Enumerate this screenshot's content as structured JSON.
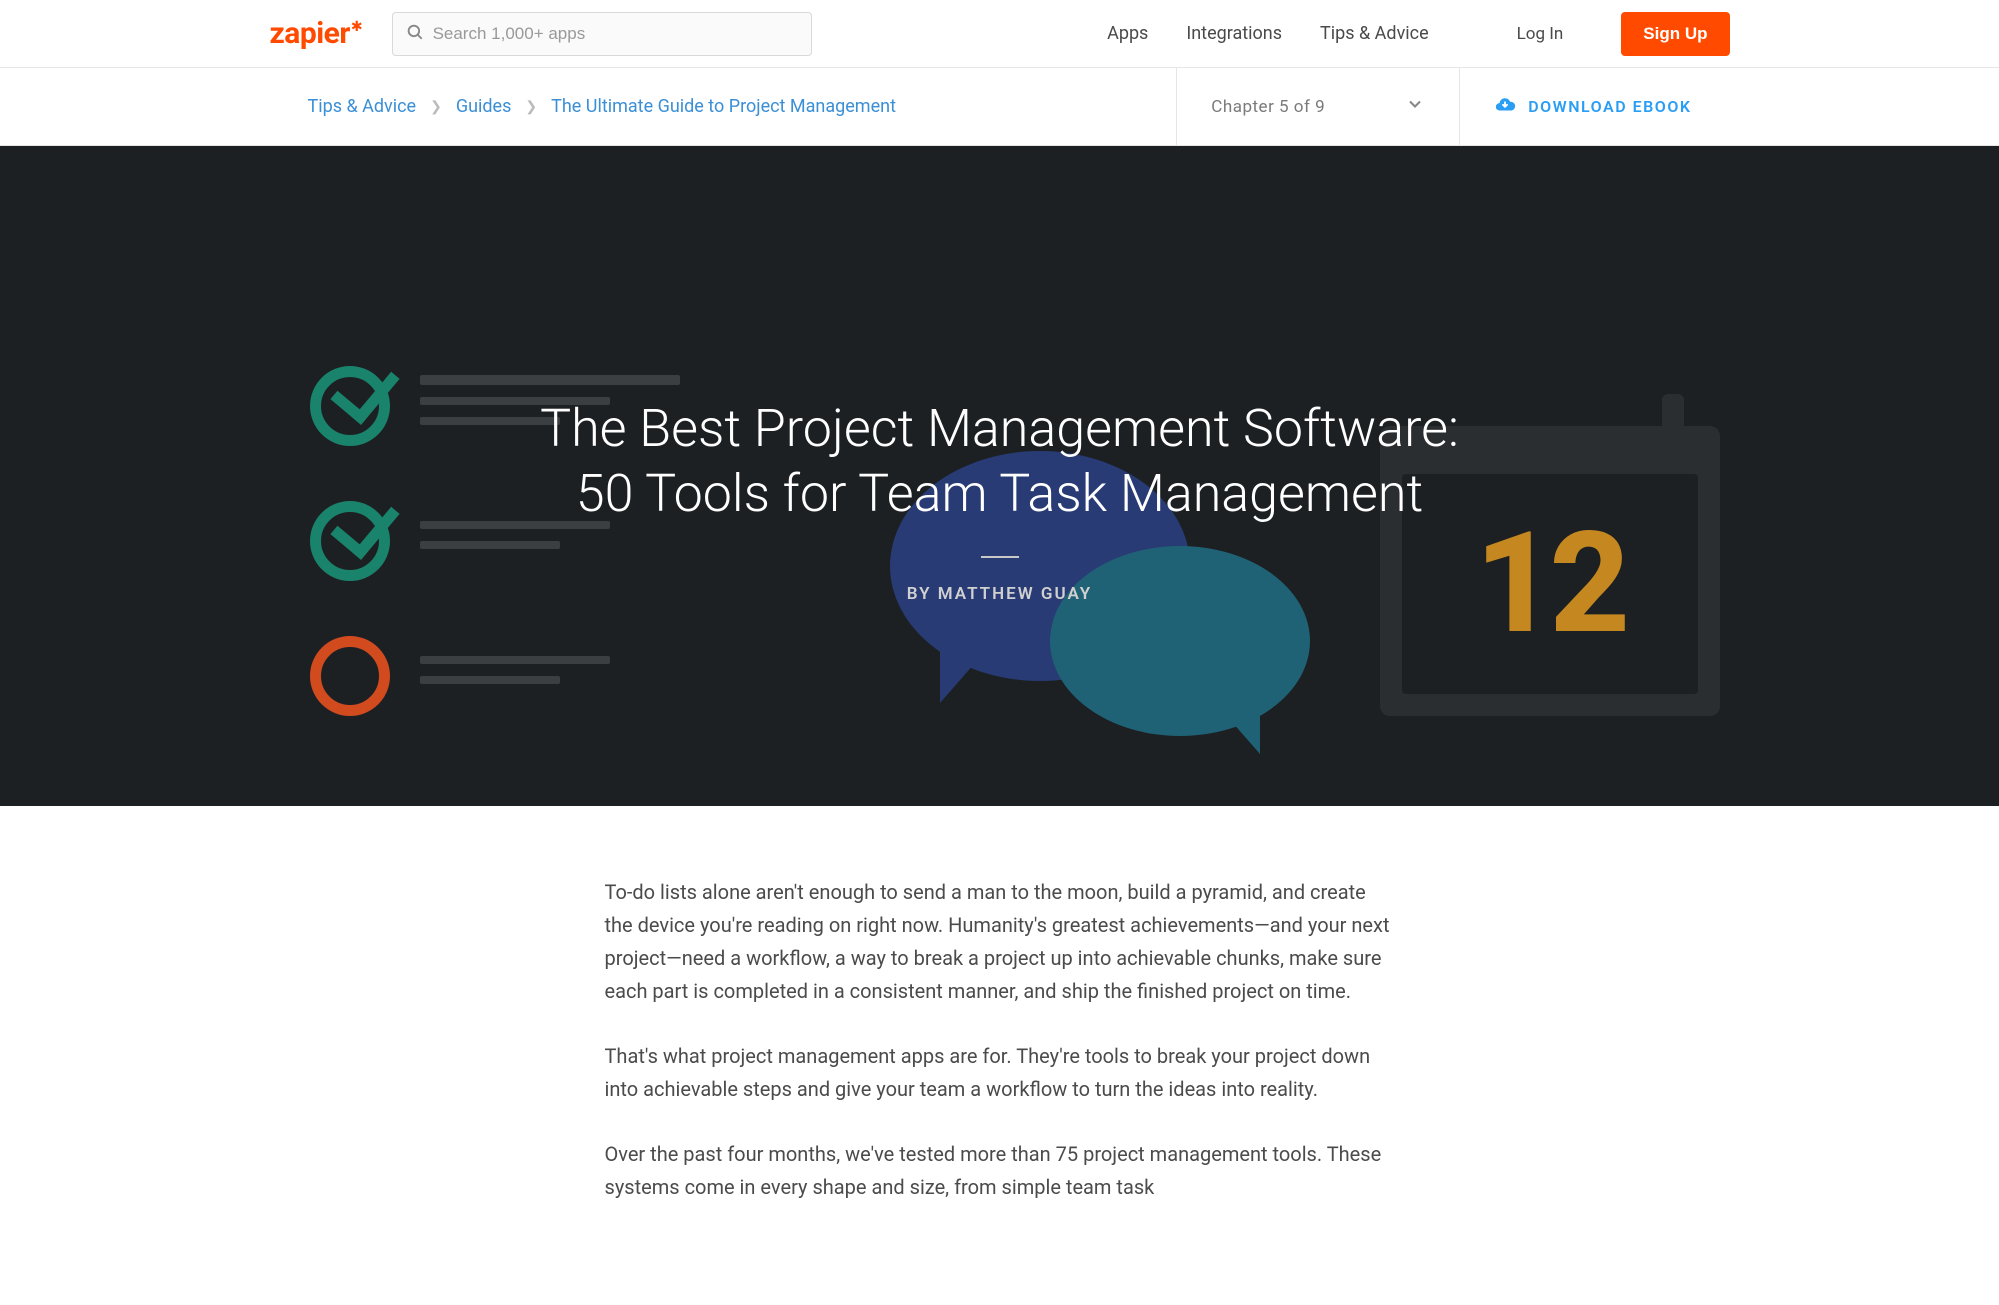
{
  "brand": "zapier",
  "search": {
    "placeholder": "Search 1,000+ apps"
  },
  "nav": {
    "apps": "Apps",
    "integrations": "Integrations",
    "tips": "Tips & Advice",
    "login": "Log In",
    "signup": "Sign Up"
  },
  "breadcrumbs": {
    "tips": "Tips & Advice",
    "guides": "Guides",
    "guide_title": "The Ultimate Guide to Project Management"
  },
  "chapter": {
    "label": "Chapter 5 of 9"
  },
  "download": {
    "label": "DOWNLOAD EBOOK"
  },
  "hero": {
    "title_line1": "The Best Project Management Software:",
    "title_line2": "50 Tools for Team Task Management",
    "byline": "BY MATTHEW GUAY",
    "calendar_day": "12"
  },
  "article": {
    "p1": "To-do lists alone aren't enough to send a man to the moon, build a pyramid, and create the device you're reading on right now. Humanity's greatest achievements—and your next project—need a workflow, a way to break a project up into achievable chunks, make sure each part is completed in a consistent manner, and ship the finished project on time.",
    "p2": "That's what project management apps are for. They're tools to break your project down into achievable steps and give your team a workflow to turn the ideas into reality.",
    "p3": "Over the past four months, we've tested more than 75 project management tools. These systems come in every shape and size, from simple team task"
  }
}
